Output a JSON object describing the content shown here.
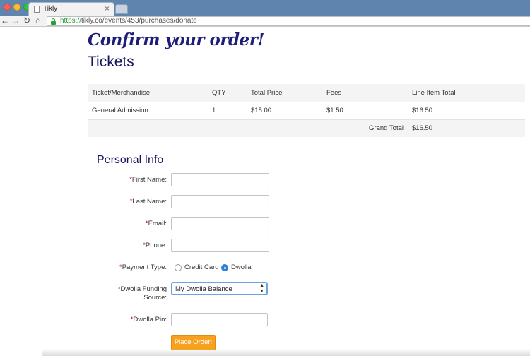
{
  "browser": {
    "tab_title": "Tikly",
    "tab_close": "×",
    "url_scheme": "https://",
    "url_rest": "tikly.co/events/453/purchases/donate",
    "icons": [
      "back-icon",
      "forward-icon",
      "reload-icon",
      "home-icon",
      "lock-icon",
      "page-icon"
    ]
  },
  "page": {
    "title": "Confirm your order!",
    "section": "Tickets"
  },
  "table": {
    "headers": [
      "Ticket/Merchandise",
      "QTY",
      "Total Price",
      "Fees",
      "Line Item Total"
    ],
    "rows": [
      [
        "General Admission",
        "1",
        "$15.00",
        "$1.50",
        "$16.50"
      ]
    ],
    "grand_total_label": "Grand Total",
    "grand_total_value": "$16.50"
  },
  "form": {
    "heading": "Personal Info",
    "required_mark": "*",
    "first_name_label": "First Name:",
    "last_name_label": "Last Name:",
    "email_label": "Email:",
    "phone_label": "Phone:",
    "payment_type_label": "Payment Type:",
    "payment_options": [
      "Credit Card",
      "Dwolla"
    ],
    "payment_selected": "Dwolla",
    "funding_label_line1": "Dwolla Funding",
    "funding_label_line2": "Source:",
    "funding_value": "My Dwolla Balance",
    "pin_label": "Dwolla Pin:",
    "submit_label": "Place Order!"
  },
  "colors": {
    "title": "#1e1e78",
    "accent_button": "#f7a11f",
    "radio_selected": "#2c7fe0",
    "required": "#b00000"
  }
}
